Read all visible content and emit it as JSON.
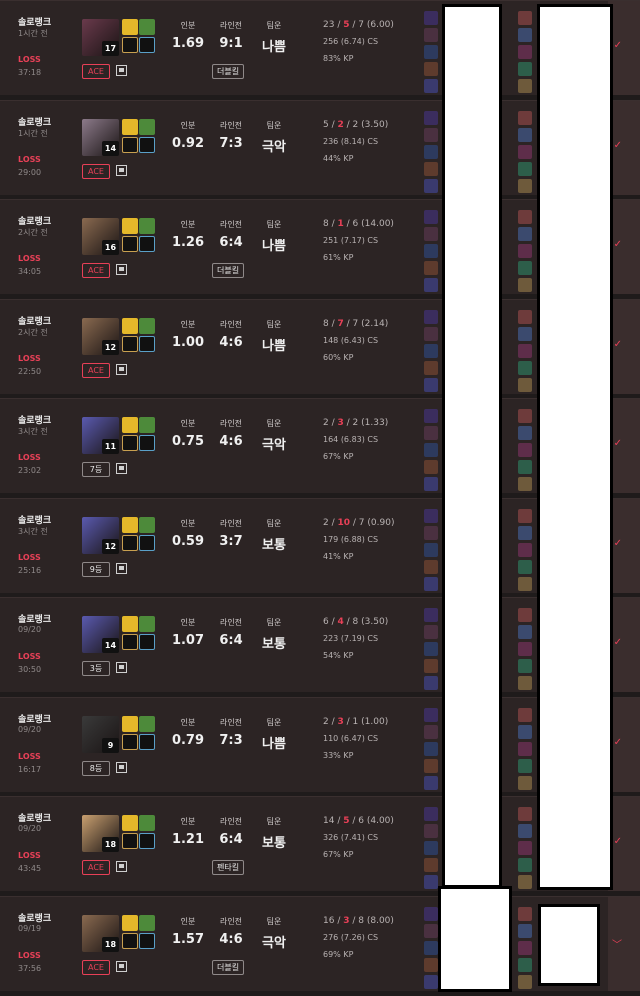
{
  "colors": {
    "loss": "#e84057",
    "background": "#2c2424"
  },
  "matches": [
    {
      "queue": "솔로랭크",
      "time": "1시간 전",
      "result": "LOSS",
      "duration": "37:18",
      "level": "17",
      "badge": "ACE",
      "badge_style": "red",
      "stats": {
        "label1": "인분",
        "value1": "1.69",
        "label2": "라인전",
        "value2": "9:1",
        "label3": "팀운",
        "value3": "나쁨"
      },
      "tag": "더블킬",
      "kills": "23",
      "deaths": "5",
      "assists": "7",
      "kda_ratio": "(6.00)",
      "cs": "256 (6.74) CS",
      "kp": "83% KP",
      "champ_color": "#6a3a4c"
    },
    {
      "queue": "솔로랭크",
      "time": "1시간 전",
      "result": "LOSS",
      "duration": "29:00",
      "level": "14",
      "badge": "ACE",
      "badge_style": "red",
      "stats": {
        "label1": "인분",
        "value1": "0.92",
        "label2": "라인전",
        "value2": "7:3",
        "label3": "팀운",
        "value3": "극악"
      },
      "tag": "",
      "kills": "5",
      "deaths": "2",
      "assists": "2",
      "kda_ratio": "(3.50)",
      "cs": "236 (8.14) CS",
      "kp": "44% KP",
      "champ_color": "#8c7a8a"
    },
    {
      "queue": "솔로랭크",
      "time": "2시간 전",
      "result": "LOSS",
      "duration": "34:05",
      "level": "16",
      "badge": "ACE",
      "badge_style": "red",
      "stats": {
        "label1": "인분",
        "value1": "1.26",
        "label2": "라인전",
        "value2": "6:4",
        "label3": "팀운",
        "value3": "나쁨"
      },
      "tag": "더블킬",
      "kills": "8",
      "deaths": "1",
      "assists": "6",
      "kda_ratio": "(14.00)",
      "cs": "251 (7.17) CS",
      "kp": "61% KP",
      "champ_color": "#8a6a50"
    },
    {
      "queue": "솔로랭크",
      "time": "2시간 전",
      "result": "LOSS",
      "duration": "22:50",
      "level": "12",
      "badge": "ACE",
      "badge_style": "red",
      "stats": {
        "label1": "인분",
        "value1": "1.00",
        "label2": "라인전",
        "value2": "4:6",
        "label3": "팀운",
        "value3": "나쁨"
      },
      "tag": "",
      "kills": "8",
      "deaths": "7",
      "assists": "7",
      "kda_ratio": "(2.14)",
      "cs": "148 (6.43) CS",
      "kp": "60% KP",
      "champ_color": "#8a6a50"
    },
    {
      "queue": "솔로랭크",
      "time": "3시간 전",
      "result": "LOSS",
      "duration": "23:02",
      "level": "11",
      "badge": "7등",
      "badge_style": "gray",
      "stats": {
        "label1": "인분",
        "value1": "0.75",
        "label2": "라인전",
        "value2": "4:6",
        "label3": "팀운",
        "value3": "극악"
      },
      "tag": "",
      "kills": "2",
      "deaths": "3",
      "assists": "2",
      "kda_ratio": "(1.33)",
      "cs": "164 (6.83) CS",
      "kp": "67% KP",
      "champ_color": "#5a5ab0"
    },
    {
      "queue": "솔로랭크",
      "time": "3시간 전",
      "result": "LOSS",
      "duration": "25:16",
      "level": "12",
      "badge": "9등",
      "badge_style": "gray",
      "stats": {
        "label1": "인분",
        "value1": "0.59",
        "label2": "라인전",
        "value2": "3:7",
        "label3": "팀운",
        "value3": "보통"
      },
      "tag": "",
      "kills": "2",
      "deaths": "10",
      "assists": "7",
      "kda_ratio": "(0.90)",
      "cs": "179 (6.88) CS",
      "kp": "41% KP",
      "champ_color": "#5a5ab0"
    },
    {
      "queue": "솔로랭크",
      "time": "09/20",
      "result": "LOSS",
      "duration": "30:50",
      "level": "14",
      "badge": "3등",
      "badge_style": "gray",
      "stats": {
        "label1": "인분",
        "value1": "1.07",
        "label2": "라인전",
        "value2": "6:4",
        "label3": "팀운",
        "value3": "보통"
      },
      "tag": "",
      "kills": "6",
      "deaths": "4",
      "assists": "8",
      "kda_ratio": "(3.50)",
      "cs": "223 (7.19) CS",
      "kp": "54% KP",
      "champ_color": "#5a5ab0"
    },
    {
      "queue": "솔로랭크",
      "time": "09/20",
      "result": "LOSS",
      "duration": "16:17",
      "level": "9",
      "badge": "8등",
      "badge_style": "gray",
      "stats": {
        "label1": "인분",
        "value1": "0.79",
        "label2": "라인전",
        "value2": "7:3",
        "label3": "팀운",
        "value3": "나쁨"
      },
      "tag": "",
      "kills": "2",
      "deaths": "3",
      "assists": "1",
      "kda_ratio": "(1.00)",
      "cs": "110 (6.47) CS",
      "kp": "33% KP",
      "champ_color": "#3a3a3a"
    },
    {
      "queue": "솔로랭크",
      "time": "09/20",
      "result": "LOSS",
      "duration": "43:45",
      "level": "18",
      "badge": "ACE",
      "badge_style": "red",
      "stats": {
        "label1": "인분",
        "value1": "1.21",
        "label2": "라인전",
        "value2": "6:4",
        "label3": "팀운",
        "value3": "보통"
      },
      "tag": "펜타킬",
      "kills": "14",
      "deaths": "5",
      "assists": "6",
      "kda_ratio": "(4.00)",
      "cs": "326 (7.41) CS",
      "kp": "67% KP",
      "champ_color": "#c9a070"
    },
    {
      "queue": "솔로랭크",
      "time": "09/19",
      "result": "LOSS",
      "duration": "37:56",
      "level": "18",
      "badge": "ACE",
      "badge_style": "red",
      "stats": {
        "label1": "인분",
        "value1": "1.57",
        "label2": "라인전",
        "value2": "4:6",
        "label3": "팀운",
        "value3": "극악"
      },
      "tag": "더블킬",
      "kills": "16",
      "deaths": "3",
      "assists": "8",
      "kda_ratio": "(8.00)",
      "cs": "276 (7.26) CS",
      "kp": "69% KP",
      "champ_color": "#8a6a50"
    }
  ],
  "icons": {
    "check": "check-icon",
    "flag": "report-flag-icon",
    "expand": "chevron-down-icon"
  }
}
